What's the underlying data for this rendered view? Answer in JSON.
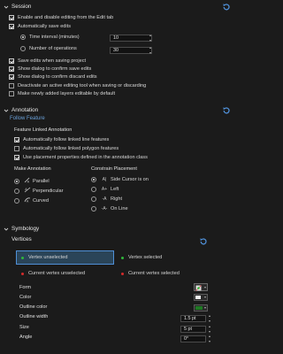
{
  "session": {
    "title": "Session",
    "enable_edit_tab": "Enable and disable editing from the Edit tab",
    "auto_save": "Automatically save edits",
    "time_interval_label": "Time interval (minutes)",
    "time_interval_value": "10",
    "num_operations_label": "Number of operations",
    "num_operations_value": "30",
    "save_on_project": "Save edits when saving project",
    "confirm_save": "Show dialog to confirm save edits",
    "confirm_discard": "Show dialog to confirm discard edits",
    "deactivate_tool": "Deactivate an active editing tool when saving or discarding",
    "new_layers_editable": "Make newly added layers editable by default"
  },
  "annotation": {
    "title": "Annotation",
    "follow_feature": "Follow Feature",
    "feature_linked": "Feature Linked Annotation",
    "follow_line": "Automatically follow linked line features",
    "follow_polygon": "Automatically follow linked polygon features",
    "use_placement": "Use placement properties defined in the annotation class",
    "make_annotation": "Make Annotation",
    "parallel": "Parallel",
    "perpendicular": "Perpendicular",
    "curved": "Curved",
    "constrain_placement": "Constrain Placement",
    "side_cursor": "Side Cursor is on",
    "left": "Left",
    "right": "Right",
    "on_line": "On Line"
  },
  "symbology": {
    "title": "Symbology",
    "vertices": "Vertices",
    "vertex_unselected": "Vertex unselected",
    "vertex_selected": "Vertex selected",
    "current_unselected": "Current vertex unselected",
    "current_selected": "Current vertex selected",
    "form": "Form",
    "color": "Color",
    "outline_color": "Outline color",
    "outline_width": "Outline width",
    "outline_width_value": "1.5 pt",
    "size": "Size",
    "size_value": "5 pt",
    "angle": "Angle",
    "angle_value": "0°"
  },
  "colors": {
    "vertex_green": "#2fb83a",
    "vertex_red": "#d52b2b",
    "outline_green": "#1f7a24",
    "accent_blue": "#4f8fd6",
    "selected_row_bg": "#2a4458"
  }
}
